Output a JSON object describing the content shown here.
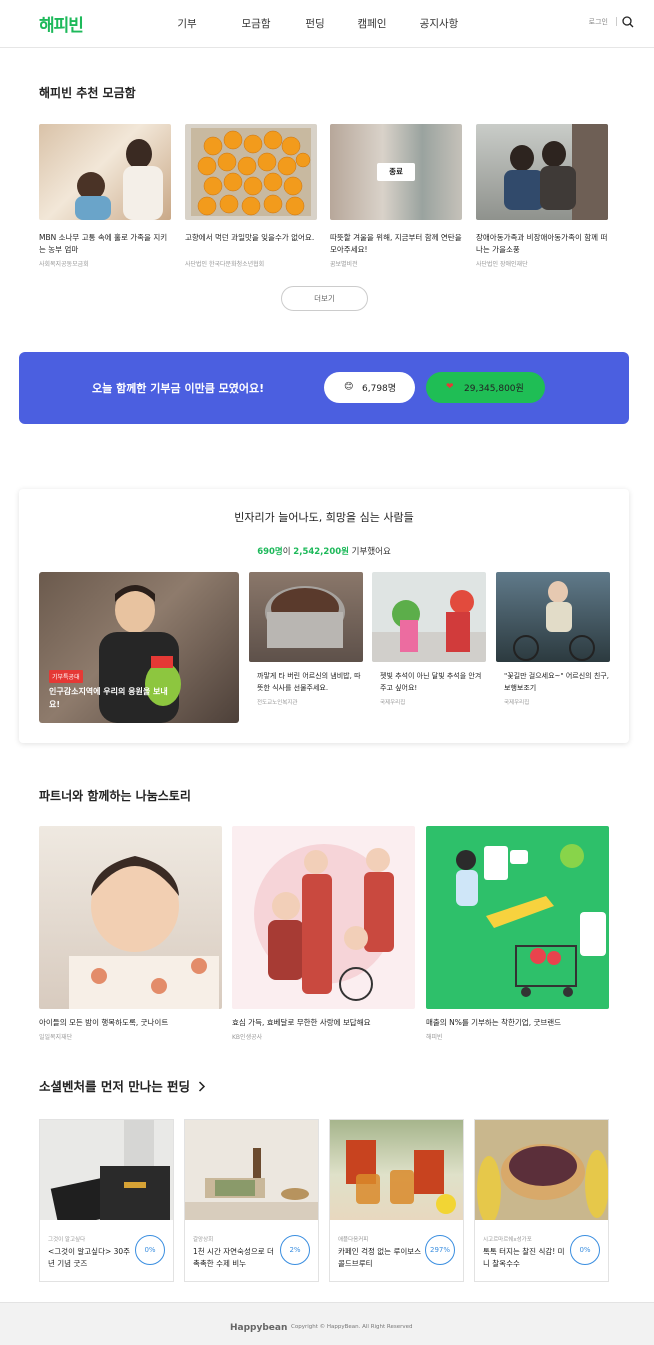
{
  "header": {
    "logo": "해피빈",
    "nav": [
      "기부",
      "모금함",
      "펀딩",
      "캠페인",
      "공지사항"
    ],
    "login": "로그인"
  },
  "recommended": {
    "title": "해피빈 추천 모금함",
    "items": [
      {
        "title": "MBN 소나무 고통 속에 홀로 가족을 지키는 농부 엄마",
        "org": "사회복지공동모금회"
      },
      {
        "title": "고향에서 먹던 과일맛을 잊을수가 없어요.",
        "org": "사단법인 한국다문화청소년협회"
      },
      {
        "title": "따뜻할 겨울을 위해, 지금부터 함께 연탄을 모아주세요!",
        "org": "꿈보별비전",
        "badge": "종료"
      },
      {
        "title": "장애아동가족과 비장애아동가족이 함께 떠나는 가을소풍",
        "org": "사단법인 장애인재단"
      }
    ],
    "more": "더보기"
  },
  "banner": {
    "text": "오늘 함께한 기부금 이만큼 모였어요!",
    "people": "6,798명",
    "amount": "29,345,800원",
    "colors": {
      "bg": "#4b5fe0",
      "green": "#1fbe55"
    }
  },
  "campaign": {
    "title": "빈자리가 늘어나도, 희망을 심는 사람들",
    "stat_people": "690명",
    "stat_mid": "이 ",
    "stat_amount": "2,542,200원",
    "stat_tail": " 기부했어요",
    "main": {
      "badge": "기부특공대",
      "text": "인구감소지역에 우리의 응원을 보내요!"
    },
    "items": [
      {
        "title": "까맣게 타 버린 어르신의 냄비밥, 따뜻한 식사를 선물주세요.",
        "org": "전도교노인복지관"
      },
      {
        "title": "젯빛 추석이 아닌 달빛 추석을 안겨 주고 싶어요!",
        "org": "국제우리집"
      },
      {
        "title": "\"꽃길만 걸으세요~\" 어르신의 친구, 보행보조기",
        "org": "국제우리집"
      }
    ]
  },
  "partner": {
    "title": "파트너와 함께하는 나눔스토리",
    "items": [
      {
        "title": "아이들의 모든 밤이 행복하도록, 굿나이트",
        "org": "일일복지재단"
      },
      {
        "title": "효심 가득, 효베달로 무한한 사랑에 보답해요",
        "org": "KB인생공사"
      },
      {
        "title": "매출의 N%를 기부하는 착한기업, 굿브랜드",
        "org": "해피빈"
      }
    ]
  },
  "funding": {
    "title": "소셜벤처를 먼저 만나는 펀딩",
    "items": [
      {
        "org": "그것이 알고싶다",
        "title": "<그것이 알고싶다> 30주년 기념 굿즈",
        "pct": "0%"
      },
      {
        "org": "갈앙상회",
        "title": "1천 시간 자연숙성으로 더 촉촉한 수제 비누",
        "pct": "2%"
      },
      {
        "org": "애플다음커피",
        "title": "카페인 걱정 없는 루이보스 콜드브루티",
        "pct": "297%"
      },
      {
        "org": "시고르마르쉐x성가포",
        "title": "톡톡 터지는 찰진 식감! 미니 찰옥수수",
        "pct": "0%"
      }
    ]
  },
  "footer": {
    "logo": "Happybean",
    "copyright": "Copyright © HappyBean. All Right Reserved"
  }
}
